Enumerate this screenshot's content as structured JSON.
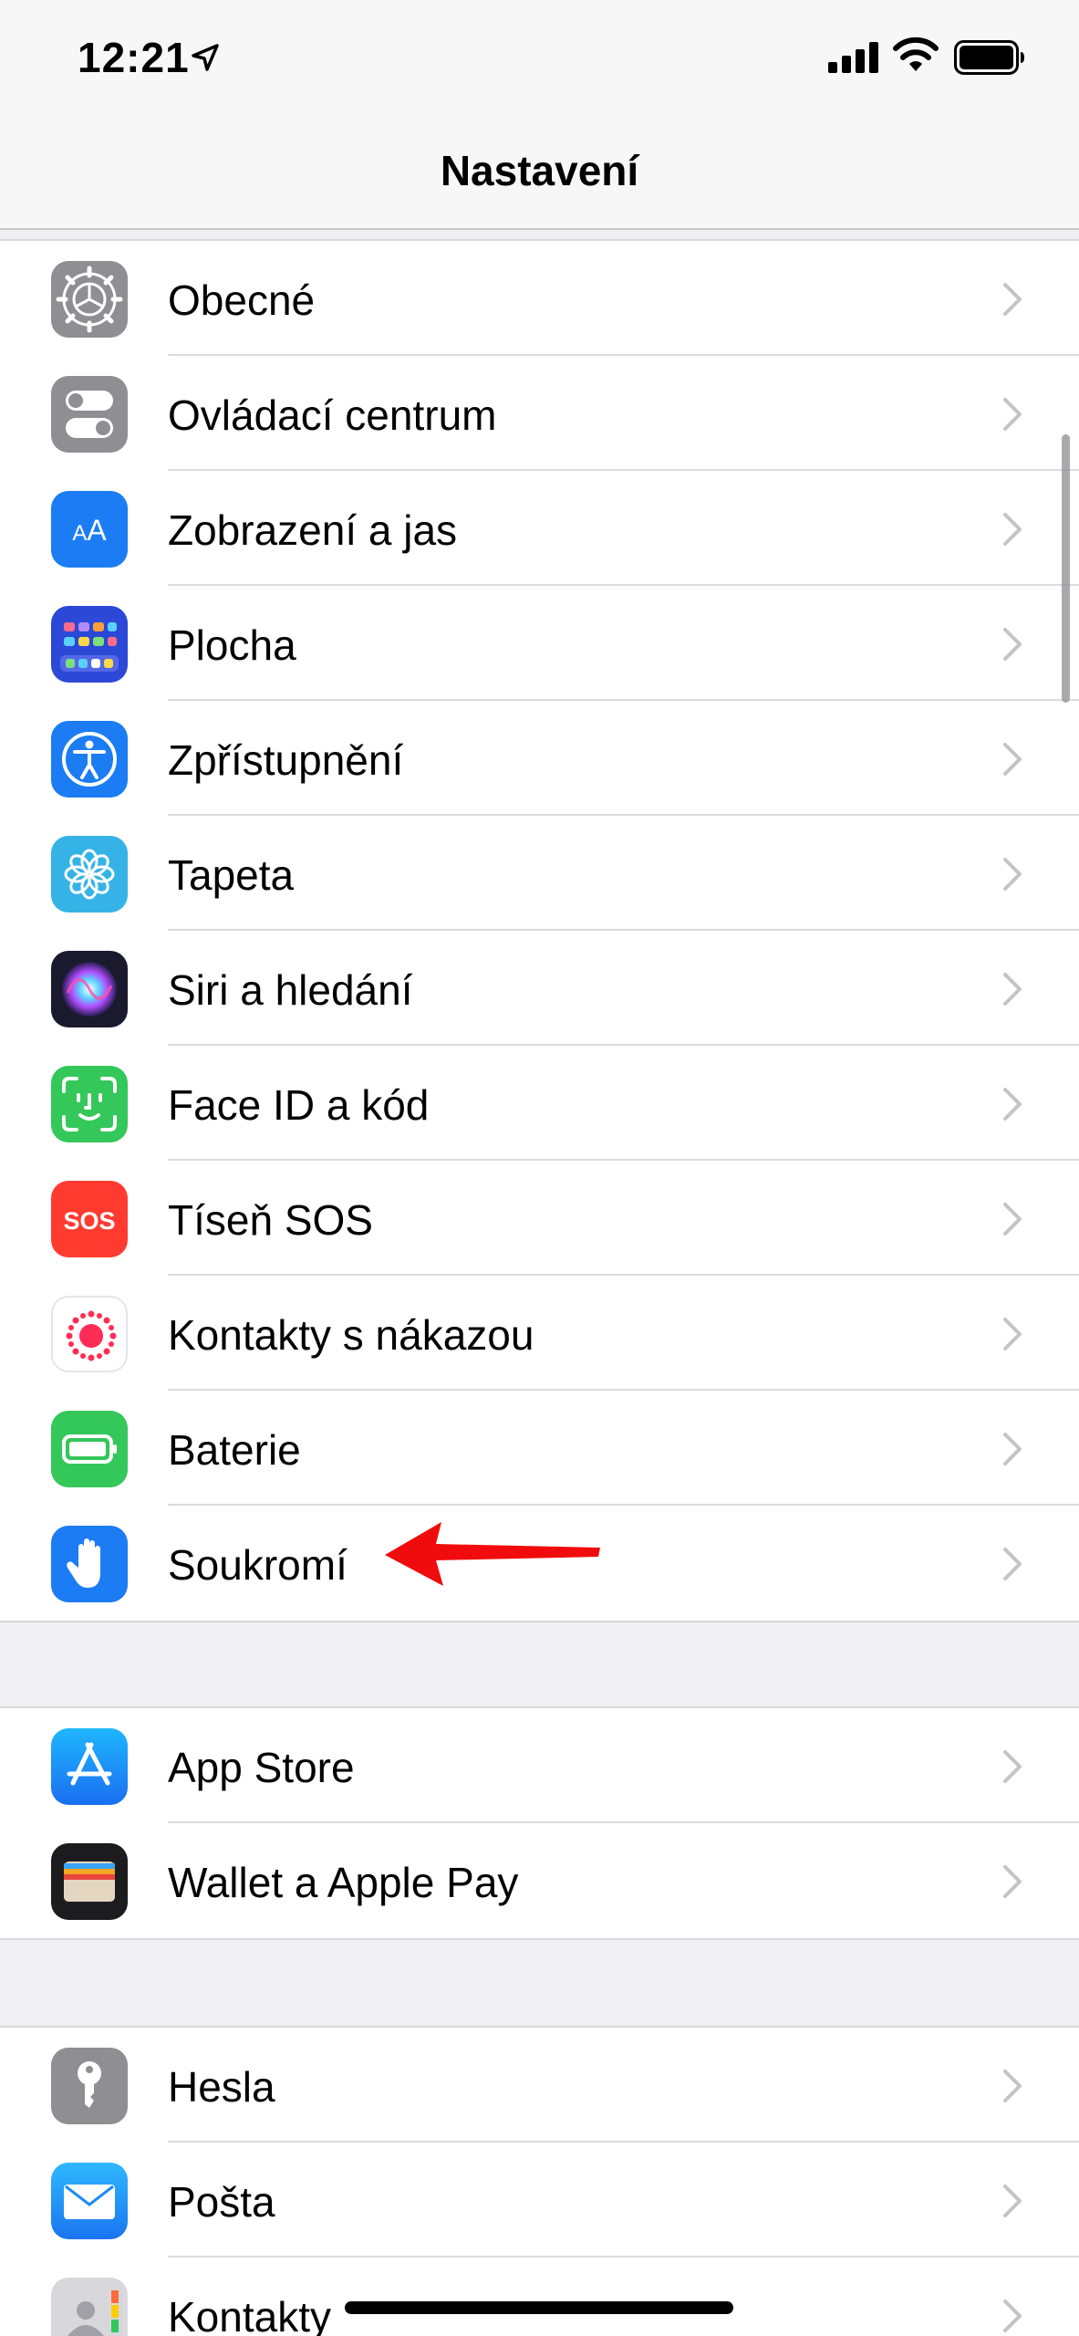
{
  "status_bar": {
    "time": "12:21"
  },
  "nav": {
    "title": "Nastavení"
  },
  "groups": [
    {
      "items": [
        {
          "label": "Obecné",
          "icon": "gear-icon",
          "color": "#8e8e93"
        },
        {
          "label": "Ovládací centrum",
          "icon": "control-center-icon",
          "color": "#8e8e93"
        },
        {
          "label": "Zobrazení a jas",
          "icon": "display-brightness-icon",
          "color": "#1b7cf4"
        },
        {
          "label": "Plocha",
          "icon": "home-screen-icon",
          "color": "#2c48d7"
        },
        {
          "label": "Zpřístupnění",
          "icon": "accessibility-icon",
          "color": "#1b7cf4"
        },
        {
          "label": "Tapeta",
          "icon": "wallpaper-icon",
          "color": "#36b3e6"
        },
        {
          "label": "Siri a hledání",
          "icon": "siri-icon",
          "color": "#1a1a2e"
        },
        {
          "label": "Face ID a kód",
          "icon": "face-id-icon",
          "color": "#34c759"
        },
        {
          "label": "Tíseň SOS",
          "icon": "sos-icon",
          "color": "#ff3b30"
        },
        {
          "label": "Kontakty s nákazou",
          "icon": "exposure-icon",
          "color": "#ffffff"
        },
        {
          "label": "Baterie",
          "icon": "battery-icon",
          "color": "#34c759"
        },
        {
          "label": "Soukromí",
          "icon": "privacy-hand-icon",
          "color": "#1b7cf4"
        }
      ]
    },
    {
      "items": [
        {
          "label": "App Store",
          "icon": "app-store-icon",
          "color": "#1b8cf4"
        },
        {
          "label": "Wallet a Apple Pay",
          "icon": "wallet-icon",
          "color": "#1c1c1e"
        }
      ]
    },
    {
      "items": [
        {
          "label": "Hesla",
          "icon": "key-icon",
          "color": "#8e8e93"
        },
        {
          "label": "Pošta",
          "icon": "mail-icon",
          "color": "#1b8cf4"
        },
        {
          "label": "Kontakty",
          "icon": "contacts-icon",
          "color": "#c7c7cc"
        }
      ]
    }
  ]
}
